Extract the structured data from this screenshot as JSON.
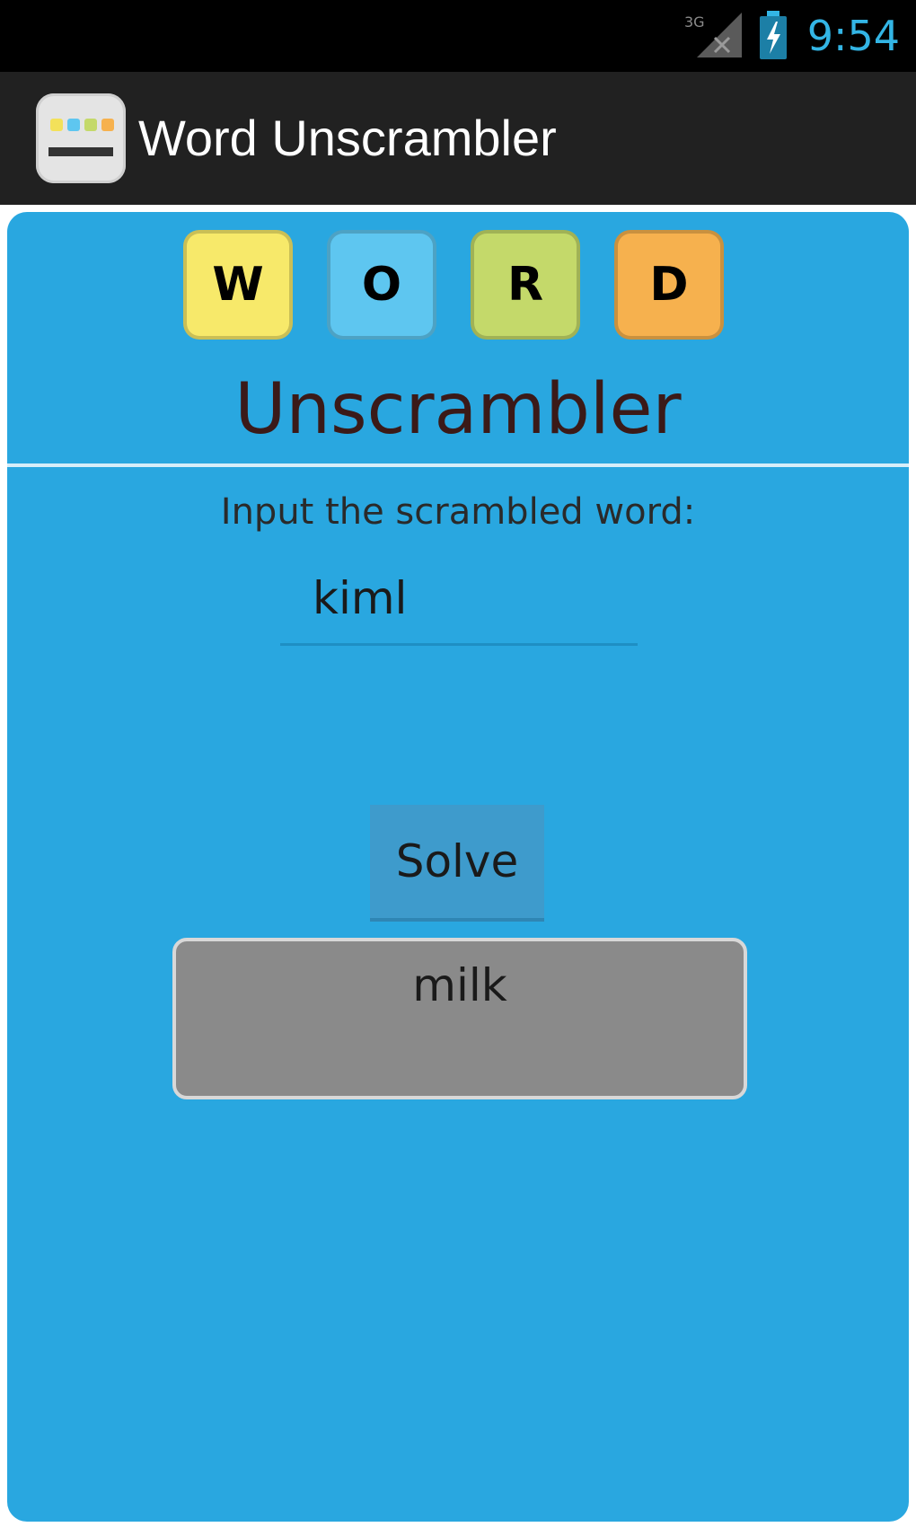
{
  "status_bar": {
    "time": "9:54",
    "network_label": "3G",
    "icons": [
      "signal-icon",
      "battery-charging-icon"
    ],
    "time_color": "#33b5e5"
  },
  "action_bar": {
    "title": "Word Unscrambler",
    "icon": "app-icon"
  },
  "main": {
    "tiles": [
      {
        "letter": "W",
        "color": "#f7e96a"
      },
      {
        "letter": "O",
        "color": "#5ec6f0"
      },
      {
        "letter": "R",
        "color": "#c4d96a"
      },
      {
        "letter": "D",
        "color": "#f6b14e"
      }
    ],
    "headline": "Unscrambler",
    "prompt": "Input the scrambled word:",
    "input_value": "kiml",
    "solve_label": "Solve",
    "result": "milk",
    "panel_color": "#29a7e0"
  }
}
